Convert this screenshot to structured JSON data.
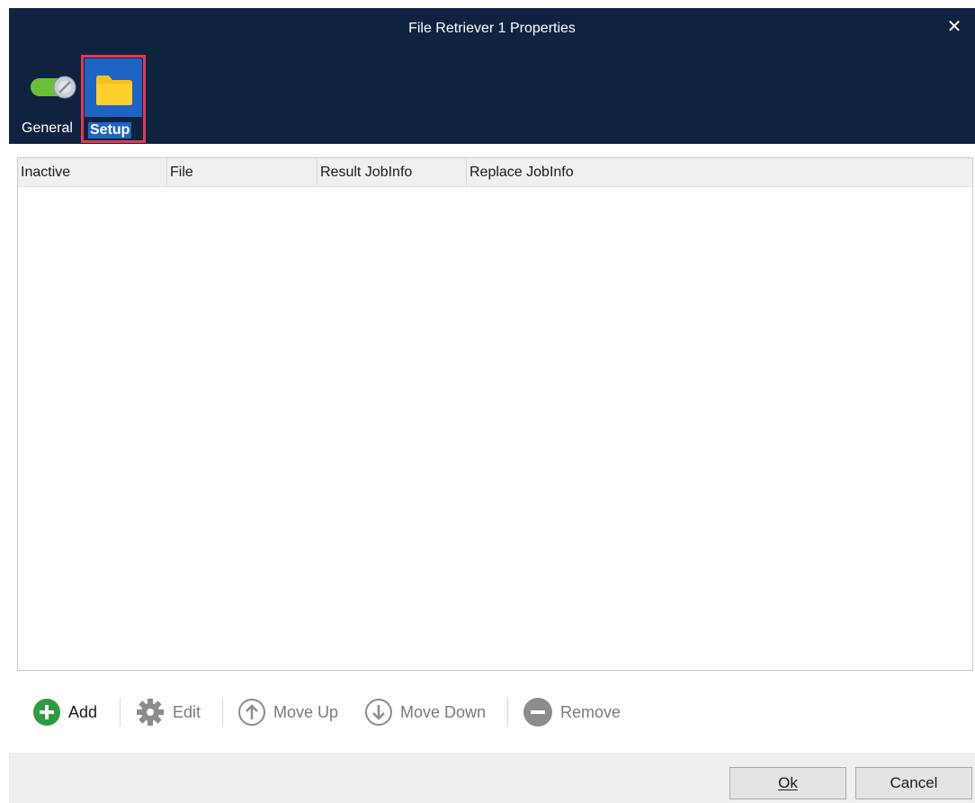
{
  "window": {
    "title": "File Retriever 1 Properties",
    "close_glyph": "✕"
  },
  "nav": {
    "general": {
      "label": "General",
      "icon": "toggle-switch-icon"
    },
    "setup": {
      "label": "Setup",
      "icon": "folder-icon"
    }
  },
  "table": {
    "columns": [
      "Inactive",
      "File",
      "Result JobInfo",
      "Replace JobInfo"
    ],
    "rows": []
  },
  "toolbar": {
    "add": "Add",
    "edit": "Edit",
    "move_up": "Move Up",
    "move_down": "Move Down",
    "remove": "Remove"
  },
  "footer": {
    "ok": "Ok",
    "cancel": "Cancel"
  },
  "colors": {
    "titlebar": "#0f2340",
    "highlight": "#1d64c4",
    "selection_border": "#e5394a",
    "add_green": "#2e9a3e"
  }
}
